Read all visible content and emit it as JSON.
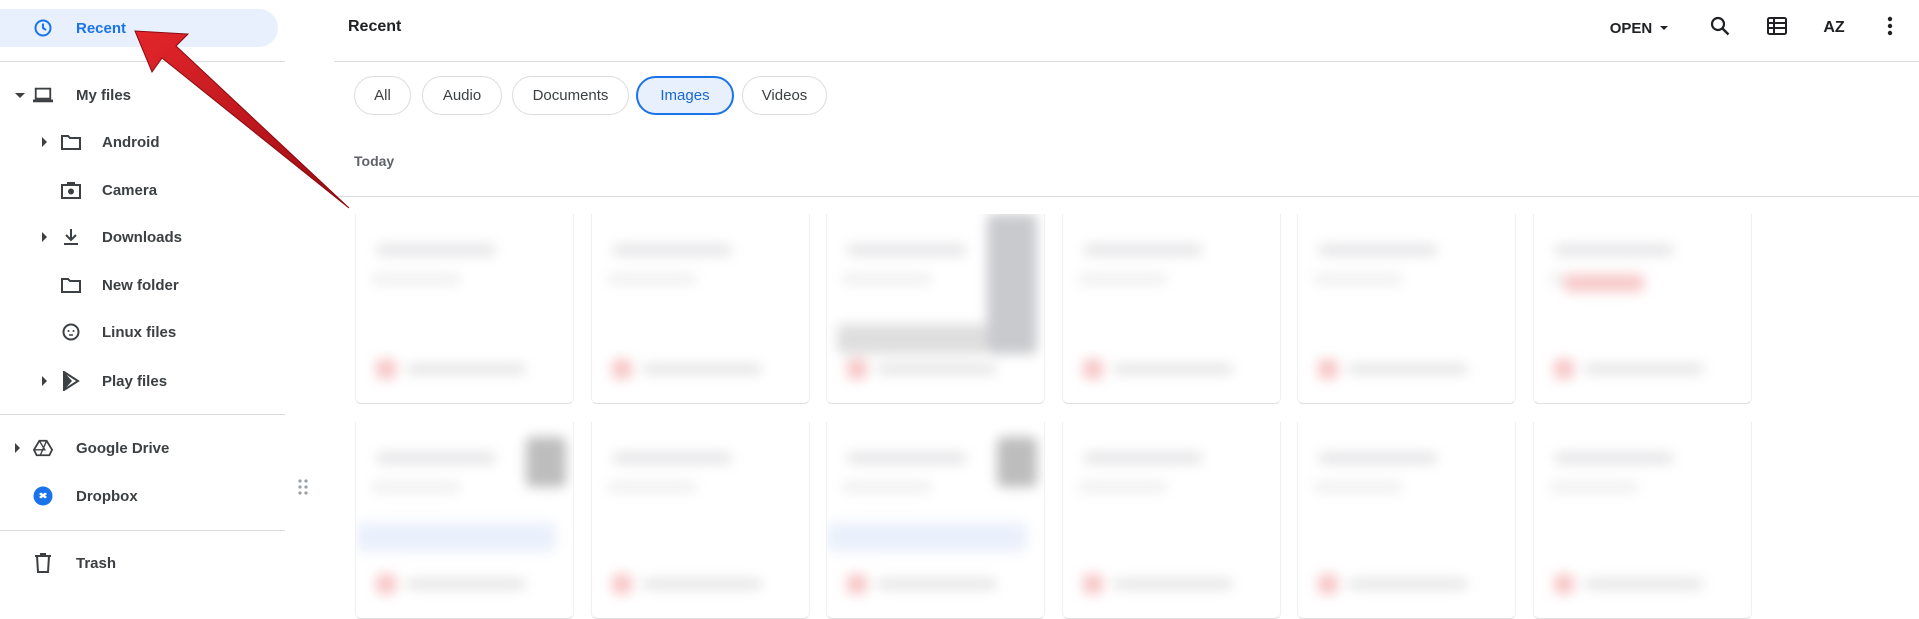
{
  "sidebar": {
    "recent": "Recent",
    "my_files": "My files",
    "children": [
      "Android",
      "Camera",
      "Downloads",
      "New folder",
      "Linux files",
      "Play files"
    ],
    "google_drive": "Google Drive",
    "dropbox": "Dropbox",
    "trash": "Trash"
  },
  "header": {
    "title": "Recent",
    "open_label": "OPEN",
    "sort_label": "AZ"
  },
  "chips": [
    "All",
    "Audio",
    "Documents",
    "Images",
    "Videos"
  ],
  "active_chip": "Images",
  "section": "Today",
  "colors": {
    "accent": "#1a73e8",
    "selected_bg": "#e8f0fe",
    "arrow": "#c8102e"
  }
}
